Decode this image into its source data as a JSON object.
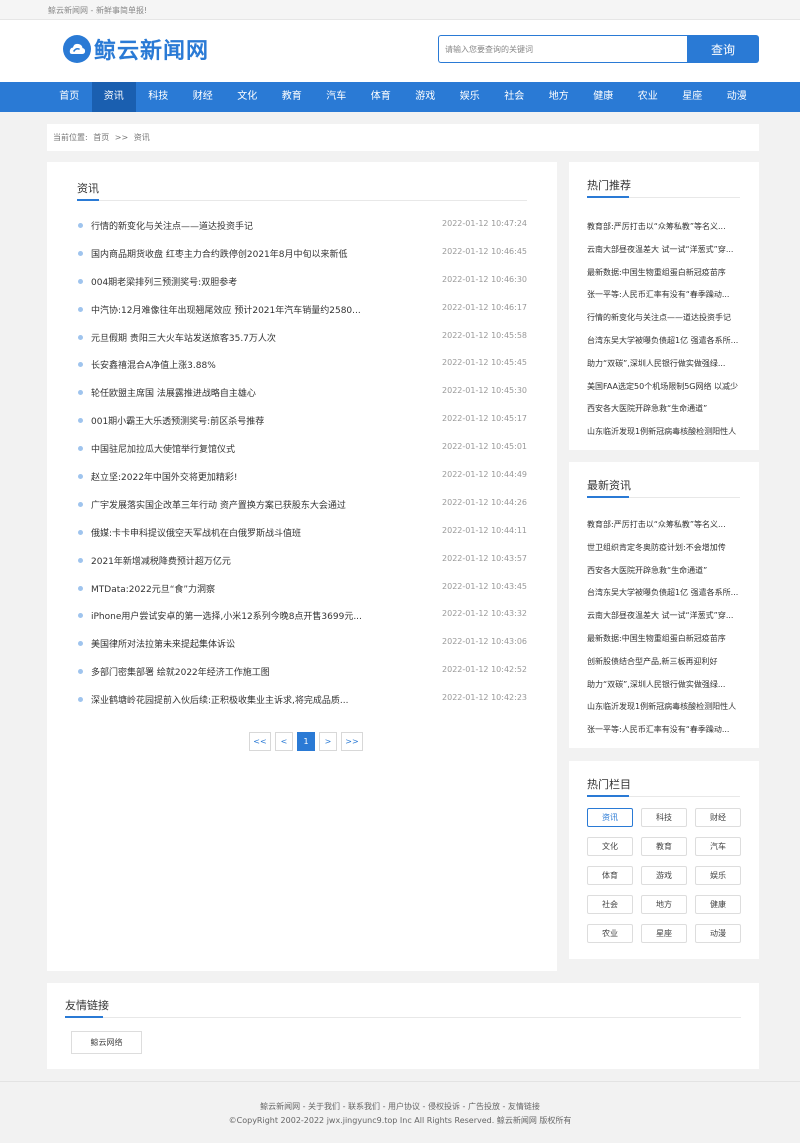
{
  "topbar": {
    "text": "鲸云新闻网 - 新鲜事简单报!"
  },
  "header": {
    "logo_text": "鲸云新闻网",
    "brand_color": "#2a7ad5",
    "search_placeholder": "请输入您要查询的关键词",
    "search_button": "查询"
  },
  "nav": {
    "items": [
      "首页",
      "资讯",
      "科技",
      "财经",
      "文化",
      "教育",
      "汽车",
      "体育",
      "游戏",
      "娱乐",
      "社会",
      "地方",
      "健康",
      "农业",
      "星座",
      "动漫"
    ],
    "active": "资讯"
  },
  "breadcrumb": {
    "label": "当前位置:",
    "home": "首页",
    "sep": ">>",
    "current": "资讯"
  },
  "main": {
    "title": "资讯",
    "articles": [
      {
        "title": "行情的新变化与关注点——道达投资手记",
        "date": "2022-01-12 10:47:24"
      },
      {
        "title": "国内商品期货收盘 红枣主力合约跌停创2021年8月中旬以来新低",
        "date": "2022-01-12 10:46:45"
      },
      {
        "title": "004期老梁排列三预测奖号:双胆参考",
        "date": "2022-01-12 10:46:30"
      },
      {
        "title": "中汽协:12月难像往年出现翘尾效应 预计2021年汽车销量约2580...",
        "date": "2022-01-12 10:46:17"
      },
      {
        "title": "元旦假期 贵阳三大火车站发送旅客35.7万人次",
        "date": "2022-01-12 10:45:58"
      },
      {
        "title": "长安鑫禧混合A净值上涨3.88%",
        "date": "2022-01-12 10:45:45"
      },
      {
        "title": "轮任欧盟主席国 法展露推进战略自主雄心",
        "date": "2022-01-12 10:45:30"
      },
      {
        "title": "001期小霸王大乐透预测奖号:前区杀号推荐",
        "date": "2022-01-12 10:45:17"
      },
      {
        "title": "中国驻尼加拉瓜大使馆举行复馆仪式",
        "date": "2022-01-12 10:45:01"
      },
      {
        "title": "赵立坚:2022年中国外交将更加精彩!",
        "date": "2022-01-12 10:44:49"
      },
      {
        "title": "广宇发展落实国企改革三年行动 资产置换方案已获股东大会通过",
        "date": "2022-01-12 10:44:26"
      },
      {
        "title": "俄媒:卡卡申科提议俄空天军战机在白俄罗斯战斗值班",
        "date": "2022-01-12 10:44:11"
      },
      {
        "title": "2021年新增减税降费预计超万亿元",
        "date": "2022-01-12 10:43:57"
      },
      {
        "title": "MTData:2022元旦“食”力洞察",
        "date": "2022-01-12 10:43:45"
      },
      {
        "title": "iPhone用户尝试安卓的第一选择,小米12系列今晚8点开售3699元...",
        "date": "2022-01-12 10:43:32"
      },
      {
        "title": "美国律所对法拉第未来提起集体诉讼",
        "date": "2022-01-12 10:43:06"
      },
      {
        "title": "多部门密集部署 绘就2022年经济工作施工图",
        "date": "2022-01-12 10:42:52"
      },
      {
        "title": "深业鹤塘岭花园提前入伙后续:正积极收集业主诉求,将完成品质...",
        "date": "2022-01-12 10:42:23"
      }
    ],
    "pager": [
      "<<",
      "<",
      "1",
      ">",
      ">>"
    ],
    "current_page": "1"
  },
  "hot": {
    "title": "热门推荐",
    "items": [
      "教育部:严厉打击以“众筹私教”等名义...",
      "云南大部昼夜温差大 试一试“洋葱式”穿...",
      "最新数据:中国生物重组蛋白新冠疫苗序",
      "张一平等:人民币汇率有没有“春季躁动...",
      "行情的新变化与关注点——道达投资手记",
      "台湾东吴大学被曝负债超1亿 强遣各系所...",
      "助力“双碳”,深圳人民银行做实做强绿...",
      "美国FAA选定50个机场限制5G网络 以减少",
      "西安各大医院开辟急救“生命通道”",
      "山东临沂发现1例新冠病毒核酸检测阳性人"
    ]
  },
  "latest": {
    "title": "最新资讯",
    "items": [
      "教育部:严厉打击以“众筹私教”等名义...",
      "世卫组织肯定冬奥防疫计划:不会增加传",
      "西安各大医院开辟急救“生命通道”",
      "台湾东吴大学被曝负债超1亿 强遣各系所...",
      "云南大部昼夜温差大 试一试“洋葱式”穿...",
      "最新数据:中国生物重组蛋白新冠疫苗序",
      "创新股债结合型产品,新三板再迎利好",
      "助力“双碳”,深圳人民银行做实做强绿...",
      "山东临沂发现1例新冠病毒核酸检测阳性人",
      "张一平等:人民币汇率有没有“春季躁动..."
    ]
  },
  "hot_columns": {
    "title": "热门栏目",
    "tags": [
      "资讯",
      "科技",
      "财经",
      "文化",
      "教育",
      "汽车",
      "体育",
      "游戏",
      "娱乐",
      "社会",
      "地方",
      "健康",
      "农业",
      "星座",
      "动漫"
    ],
    "selected": "资讯"
  },
  "friend_links": {
    "title": "友情链接",
    "items": [
      "鲸云网络"
    ]
  },
  "footer": {
    "links": "鲸云新闻网 - 关于我们 - 联系我们 - 用户协议 - 侵权投诉 - 广告投放 - 友情链接",
    "copyright": "©CopyRight 2002-2022 jwx.jingyunc9.top Inc All Rights Reserved. 鲸云新闻网 版权所有"
  }
}
